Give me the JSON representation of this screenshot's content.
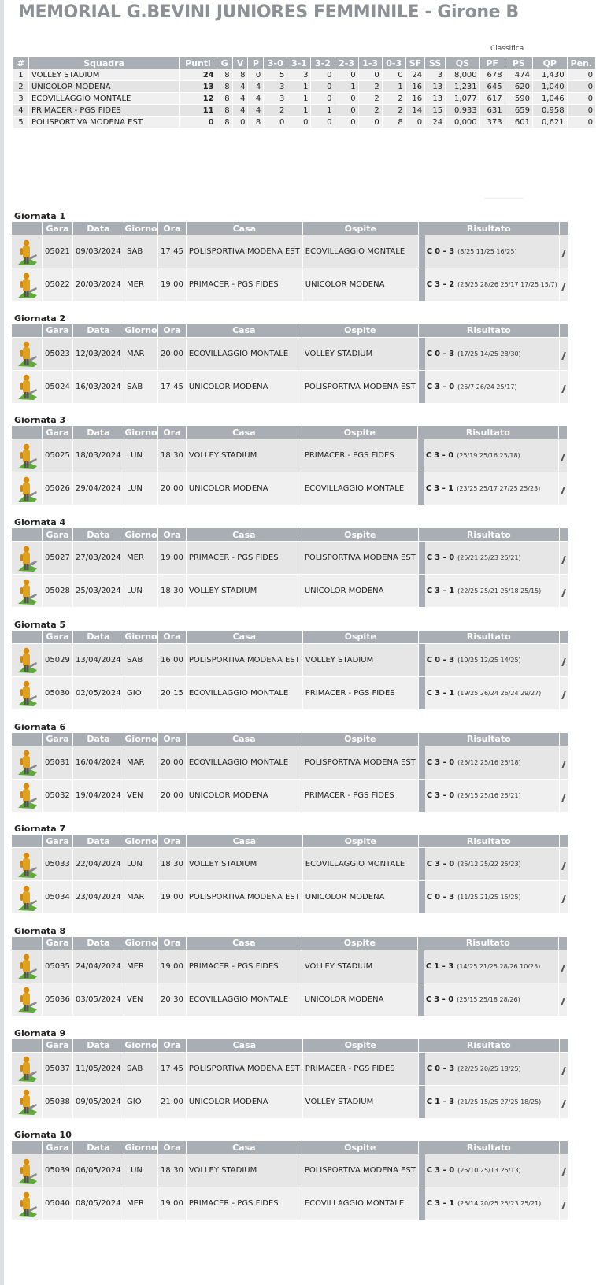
{
  "title": "MEMORIAL G.BEVINI JUNIORES FEMMINILE - Girone B",
  "standings_caption": "Classifica",
  "standings": {
    "headers": [
      "#",
      "Squadra",
      "Punti",
      "G",
      "V",
      "P",
      "3-0",
      "3-1",
      "3-2",
      "2-3",
      "1-3",
      "0-3",
      "SF",
      "SS",
      "QS",
      "PF",
      "PS",
      "QP",
      "Pen."
    ],
    "rows": [
      [
        "1",
        "VOLLEY STADIUM",
        "24",
        "8",
        "8",
        "0",
        "5",
        "3",
        "0",
        "0",
        "0",
        "0",
        "24",
        "3",
        "8,000",
        "678",
        "474",
        "1,430",
        "0"
      ],
      [
        "2",
        "UNICOLOR MODENA",
        "13",
        "8",
        "4",
        "4",
        "3",
        "1",
        "0",
        "1",
        "2",
        "1",
        "16",
        "13",
        "1,231",
        "645",
        "620",
        "1,040",
        "0"
      ],
      [
        "3",
        "ECOVILLAGGIO MONTALE",
        "12",
        "8",
        "4",
        "4",
        "3",
        "1",
        "0",
        "0",
        "2",
        "2",
        "16",
        "13",
        "1,077",
        "617",
        "590",
        "1,046",
        "0"
      ],
      [
        "4",
        "PRIMACER - PGS FIDES",
        "11",
        "8",
        "4",
        "4",
        "2",
        "1",
        "1",
        "0",
        "2",
        "2",
        "14",
        "15",
        "0,933",
        "631",
        "659",
        "0,958",
        "0"
      ],
      [
        "5",
        "POLISPORTIVA MODENA EST",
        "0",
        "8",
        "0",
        "8",
        "0",
        "0",
        "0",
        "0",
        "0",
        "8",
        "0",
        "24",
        "0,000",
        "373",
        "601",
        "0,621",
        "0"
      ]
    ]
  },
  "match_headers": [
    "",
    "Gara",
    "Data",
    "Giorno",
    "Ora",
    "Casa",
    "Ospite",
    "Risultato"
  ],
  "giornate": [
    {
      "title": "Giornata 1",
      "matches": [
        {
          "gara": "05021",
          "data": "09/03/2024",
          "giorno": "SAB",
          "ora": "17:45",
          "casa": "POLISPORTIVA MODENA EST",
          "ospite": "ECOVILLAGGIO MONTALE",
          "c": "C",
          "score": "0 - 3",
          "sets": "(8/25 11/25 16/25)"
        },
        {
          "gara": "05022",
          "data": "20/03/2024",
          "giorno": "MER",
          "ora": "19:00",
          "casa": "PRIMACER - PGS FIDES",
          "ospite": "UNICOLOR MODENA",
          "c": "C",
          "score": "3 - 2",
          "sets": "(23/25 28/26 25/17 17/25 15/7)"
        }
      ]
    },
    {
      "title": "Giornata 2",
      "matches": [
        {
          "gara": "05023",
          "data": "12/03/2024",
          "giorno": "MAR",
          "ora": "20:00",
          "casa": "ECOVILLAGGIO MONTALE",
          "ospite": "VOLLEY STADIUM",
          "c": "C",
          "score": "0 - 3",
          "sets": "(17/25 14/25 28/30)"
        },
        {
          "gara": "05024",
          "data": "16/03/2024",
          "giorno": "SAB",
          "ora": "17:45",
          "casa": "UNICOLOR MODENA",
          "ospite": "POLISPORTIVA MODENA EST",
          "c": "C",
          "score": "3 - 0",
          "sets": "(25/7 26/24 25/17)"
        }
      ]
    },
    {
      "title": "Giornata 3",
      "matches": [
        {
          "gara": "05025",
          "data": "18/03/2024",
          "giorno": "LUN",
          "ora": "18:30",
          "casa": "VOLLEY STADIUM",
          "ospite": "PRIMACER - PGS FIDES",
          "c": "C",
          "score": "3 - 0",
          "sets": "(25/19 25/16 25/18)"
        },
        {
          "gara": "05026",
          "data": "29/04/2024",
          "giorno": "LUN",
          "ora": "20:00",
          "casa": "UNICOLOR MODENA",
          "ospite": "ECOVILLAGGIO MONTALE",
          "c": "C",
          "score": "3 - 1",
          "sets": "(23/25 25/17 27/25 25/23)"
        }
      ]
    },
    {
      "title": "Giornata 4",
      "matches": [
        {
          "gara": "05027",
          "data": "27/03/2024",
          "giorno": "MER",
          "ora": "19:00",
          "casa": "PRIMACER - PGS FIDES",
          "ospite": "POLISPORTIVA MODENA EST",
          "c": "C",
          "score": "3 - 0",
          "sets": "(25/21 25/23 25/21)"
        },
        {
          "gara": "05028",
          "data": "25/03/2024",
          "giorno": "LUN",
          "ora": "18:30",
          "casa": "VOLLEY STADIUM",
          "ospite": "UNICOLOR MODENA",
          "c": "C",
          "score": "3 - 1",
          "sets": "(22/25 25/21 25/18 25/15)"
        }
      ]
    },
    {
      "title": "Giornata 5",
      "matches": [
        {
          "gara": "05029",
          "data": "13/04/2024",
          "giorno": "SAB",
          "ora": "16:00",
          "casa": "POLISPORTIVA MODENA EST",
          "ospite": "VOLLEY STADIUM",
          "c": "C",
          "score": "0 - 3",
          "sets": "(10/25 12/25 14/25)"
        },
        {
          "gara": "05030",
          "data": "02/05/2024",
          "giorno": "GIO",
          "ora": "20:15",
          "casa": "ECOVILLAGGIO MONTALE",
          "ospite": "PRIMACER - PGS FIDES",
          "c": "C",
          "score": "3 - 1",
          "sets": "(19/25 26/24 26/24 29/27)"
        }
      ]
    },
    {
      "title": "Giornata 6",
      "matches": [
        {
          "gara": "05031",
          "data": "16/04/2024",
          "giorno": "MAR",
          "ora": "20:00",
          "casa": "ECOVILLAGGIO MONTALE",
          "ospite": "POLISPORTIVA MODENA EST",
          "c": "C",
          "score": "3 - 0",
          "sets": "(25/12 25/16 25/18)"
        },
        {
          "gara": "05032",
          "data": "19/04/2024",
          "giorno": "VEN",
          "ora": "20:00",
          "casa": "UNICOLOR MODENA",
          "ospite": "PRIMACER - PGS FIDES",
          "c": "C",
          "score": "3 - 0",
          "sets": "(25/15 25/16 25/21)"
        }
      ]
    },
    {
      "title": "Giornata 7",
      "matches": [
        {
          "gara": "05033",
          "data": "22/04/2024",
          "giorno": "LUN",
          "ora": "18:30",
          "casa": "VOLLEY STADIUM",
          "ospite": "ECOVILLAGGIO MONTALE",
          "c": "C",
          "score": "3 - 0",
          "sets": "(25/12 25/22 25/23)"
        },
        {
          "gara": "05034",
          "data": "23/04/2024",
          "giorno": "MAR",
          "ora": "19:00",
          "casa": "POLISPORTIVA MODENA EST",
          "ospite": "UNICOLOR MODENA",
          "c": "C",
          "score": "0 - 3",
          "sets": "(11/25 21/25 15/25)"
        }
      ]
    },
    {
      "title": "Giornata 8",
      "matches": [
        {
          "gara": "05035",
          "data": "24/04/2024",
          "giorno": "MER",
          "ora": "19:00",
          "casa": "PRIMACER - PGS FIDES",
          "ospite": "VOLLEY STADIUM",
          "c": "C",
          "score": "1 - 3",
          "sets": "(14/25 21/25 28/26 10/25)"
        },
        {
          "gara": "05036",
          "data": "03/05/2024",
          "giorno": "VEN",
          "ora": "20:30",
          "casa": "ECOVILLAGGIO MONTALE",
          "ospite": "UNICOLOR MODENA",
          "c": "C",
          "score": "3 - 0",
          "sets": "(25/15 25/18 28/26)"
        }
      ]
    },
    {
      "title": "Giornata 9",
      "matches": [
        {
          "gara": "05037",
          "data": "11/05/2024",
          "giorno": "SAB",
          "ora": "17:45",
          "casa": "POLISPORTIVA MODENA EST",
          "ospite": "PRIMACER - PGS FIDES",
          "c": "C",
          "score": "0 - 3",
          "sets": "(22/25 20/25 18/25)"
        },
        {
          "gara": "05038",
          "data": "09/05/2024",
          "giorno": "GIO",
          "ora": "21:00",
          "casa": "UNICOLOR MODENA",
          "ospite": "VOLLEY STADIUM",
          "c": "C",
          "score": "1 - 3",
          "sets": "(21/25 15/25 27/25 18/25)"
        }
      ]
    },
    {
      "title": "Giornata 10",
      "matches": [
        {
          "gara": "05039",
          "data": "06/05/2024",
          "giorno": "LUN",
          "ora": "18:30",
          "casa": "VOLLEY STADIUM",
          "ospite": "POLISPORTIVA MODENA EST",
          "c": "C",
          "score": "3 - 0",
          "sets": "(25/10 25/13 25/13)"
        },
        {
          "gara": "05040",
          "data": "08/05/2024",
          "giorno": "MER",
          "ora": "19:00",
          "casa": "PRIMACER - PGS FIDES",
          "ospite": "ECOVILLAGGIO MONTALE",
          "c": "C",
          "score": "3 - 1",
          "sets": "(25/14 20/25 25/23 25/21)"
        }
      ]
    }
  ],
  "icons": {
    "match_icon": "referee-player-icon",
    "edge_icon": "pencil-edge-icon"
  },
  "colors": {
    "header_bg": "#a9aeb4",
    "title": "#8d9196",
    "row_a": "#f0f0f0",
    "row_b": "#e4e4e4",
    "icon_body": "#e0a21a",
    "icon_base": "#5ea938"
  }
}
